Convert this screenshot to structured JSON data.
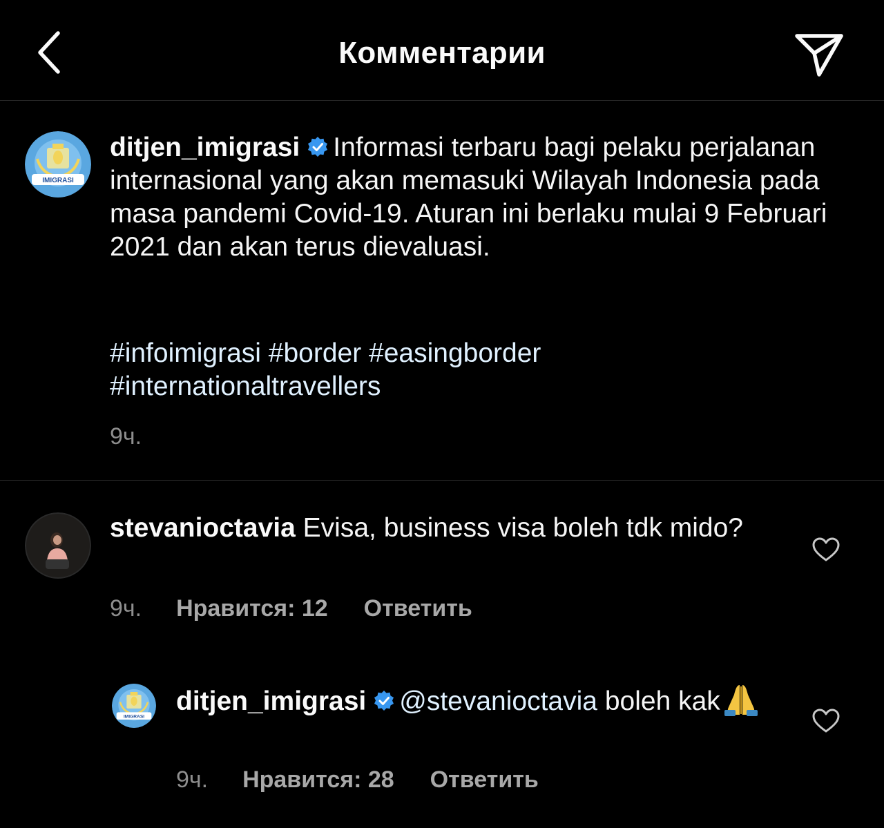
{
  "header": {
    "title": "Комментарии",
    "back_icon": "chevron-left-icon",
    "share_icon": "paper-plane-icon"
  },
  "caption": {
    "username": "ditjen_imigrasi",
    "verified": true,
    "text": "Informasi terbaru bagi pelaku perjalanan internasional yang akan memasuki Wilayah Indonesia pada masa pandemi Covid-19. Aturan ini berlaku mulai 9 Februari 2021 dan akan terus dievaluasi.",
    "hashtags": [
      "#infoimigrasi",
      "#border",
      "#easingborder",
      "#internationaltravellers"
    ],
    "time": "9ч."
  },
  "comments": [
    {
      "username": "stevanioctavia",
      "text": "Evisa, business visa boleh tdk mido?",
      "time": "9ч.",
      "likes": "Нравится: 12",
      "reply": "Ответить"
    }
  ],
  "replies": [
    {
      "username": "ditjen_imigrasi",
      "verified": true,
      "mention": "@stevanioctavia",
      "text": "boleh kak",
      "emoji": "🙏",
      "time": "9ч.",
      "likes": "Нравится: 28",
      "reply": "Ответить"
    }
  ],
  "colors": {
    "background": "#000000",
    "verified_badge": "#3897f0",
    "meta_text": "#8e8e8e",
    "divider": "#262626"
  }
}
